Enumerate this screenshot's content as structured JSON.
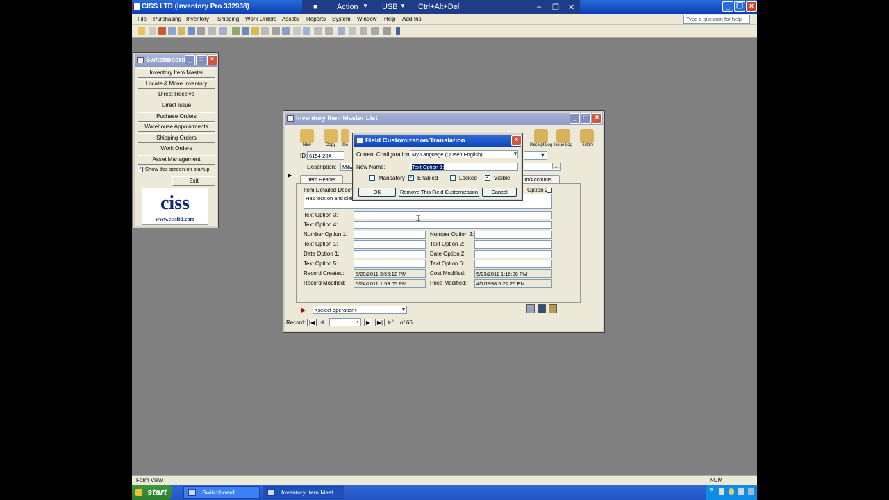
{
  "rdp": {
    "action": "Action",
    "usb": "USB",
    "cad": "Ctrl+Alt+Del",
    "arrow": "▼",
    "pin": "■"
  },
  "app": {
    "title": "CISS LTD (Inventory Pro 332938)"
  },
  "menu": [
    "File",
    "Purchasing",
    "Inventory",
    "Shipping",
    "Work Orders",
    "Assets",
    "Reports",
    "System",
    "Window",
    "Help",
    "Add-Ins"
  ],
  "help_placeholder": "Type a question for help",
  "switchboard": {
    "title": "Switchboard",
    "buttons": [
      "Inventory Item Master",
      "Locate & Move Inventory",
      "Direct Receive",
      "Direct Issue",
      "Puchase Orders",
      "Warehouse Appointments",
      "Shipping Orders",
      "Work Orders",
      "Asset Management"
    ],
    "startup_label": "Show this screen on startup",
    "startup_checked": true,
    "exit_label": "Exit",
    "logo_text": "ciss",
    "logo_url": "www.cissltd.com"
  },
  "inventory": {
    "title": "Inventory Item Master List",
    "toolbar_left": [
      {
        "label": "New",
        "icon": "new-icon"
      },
      {
        "label": "Copy",
        "icon": "copy-icon"
      },
      {
        "label": "Go",
        "icon": "go-icon"
      }
    ],
    "toolbar_right": [
      {
        "label": "Receipt Log",
        "icon": "receipt-log-icon"
      },
      {
        "label": "Issue Log",
        "icon": "issue-log-icon"
      },
      {
        "label": "History",
        "icon": "history-icon"
      }
    ],
    "id_label": "ID:",
    "id_value": "6154-20A",
    "description_label": "Description:",
    "description_value": "Milw",
    "tabs": [
      "Item Header",
      "m/Accounts"
    ],
    "detailed_desc_label": "Item Detailed Descr",
    "detailed_desc_value": "Has lock on and dial speed control, pommel & clamp mirror and duty adjustable guard. 4.0 in",
    "option2_label": "Option 2:",
    "fields_left": [
      {
        "label": "Text Option 3:",
        "value": ""
      },
      {
        "label": "Text Option 4:",
        "value": ""
      },
      {
        "label": "Number Option 1:",
        "value": ""
      },
      {
        "label": "Text Option 1:",
        "value": ""
      },
      {
        "label": "Date Option 1:",
        "value": ""
      },
      {
        "label": "Text Option 5:",
        "value": ""
      },
      {
        "label": "Record Created:",
        "value": "5/20/2011 3:56:12 PM"
      },
      {
        "label": "Record Modified:",
        "value": "5/24/2011 1:53:05 PM"
      }
    ],
    "fields_right": [
      {
        "label": "Number Option 2:",
        "value": ""
      },
      {
        "label": "Text Option  2:",
        "value": ""
      },
      {
        "label": "Date Option 2:",
        "value": ""
      },
      {
        "label": "Text Option  6:",
        "value": ""
      },
      {
        "label": "Cost Modified:",
        "value": "5/23/2011 1:16:06 PM"
      },
      {
        "label": "Price Modified:",
        "value": "4/7/1998 5:21:25 PM"
      }
    ],
    "operation_placeholder": "<select operation>",
    "record_label": "Record:",
    "record_current": "1",
    "record_of": "of  66"
  },
  "dialog": {
    "title": "Field Customization/Translation",
    "config_label": "Current Configuration:",
    "config_value": "My Language (Queen English)",
    "new_name_label": "New Name:",
    "new_name_value": "Text Option 1:",
    "mandatory_label": "Mandatory",
    "mandatory_checked": false,
    "enabled_label": "Enabled",
    "enabled_checked": true,
    "locked_label": "Locked",
    "locked_checked": false,
    "visible_label": "Visible",
    "visible_checked": true,
    "ok_label": "OK",
    "remove_label": "Remove This Field Customization",
    "cancel_label": "Cancel"
  },
  "status": {
    "left": "Form View",
    "num": "NUM"
  },
  "taskbar": {
    "start": "start",
    "tasks": [
      "Switchboard",
      "Inventory Item Mast..."
    ]
  },
  "colors": {
    "titlebar": "#0b45b8",
    "close": "#d0563d",
    "taskbar": "#2453c4",
    "start": "#2e7d2e"
  }
}
